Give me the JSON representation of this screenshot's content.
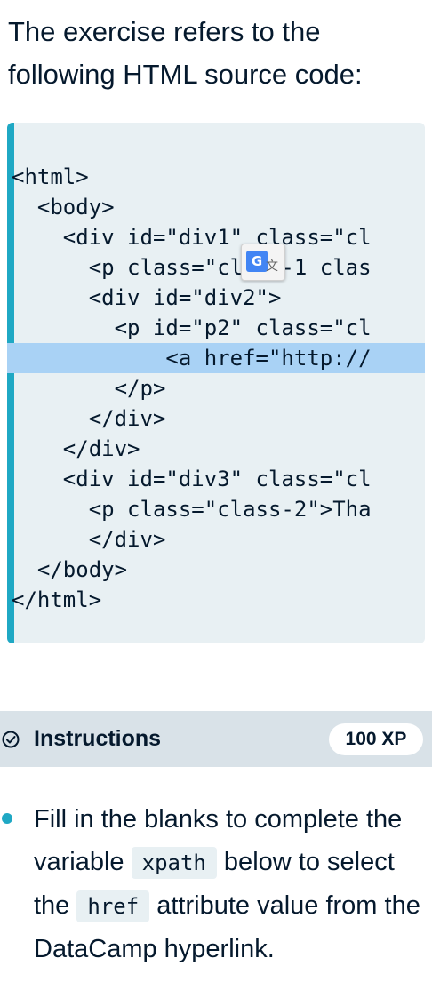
{
  "intro": {
    "text": "The exercise refers to the following HTML source code:"
  },
  "code": {
    "lines": [
      "<html>",
      "  <body>",
      "    <div id=\"div1\" class=\"cl",
      "      <p class=\"class-1 clas",
      "      <div id=\"div2\">",
      "        <p id=\"p2\" class=\"cl",
      "            <a href=\"http://",
      "        </p>",
      "      </div>",
      "    </div>",
      "    <div id=\"div3\" class=\"cl",
      "      <p class=\"class-2\">Tha",
      "      </div>",
      "  </body>",
      "</html>"
    ],
    "highlighted_line": 6
  },
  "translate_overlay": {
    "icon": "google-translate-icon",
    "letter": "G",
    "mark": "文"
  },
  "instructions": {
    "title": "Instructions",
    "xp": "100 XP",
    "check_icon": "check-circle-icon",
    "bullet": {
      "before_xpath": "Fill in the blanks to complete the variable ",
      "code_1": "xpath",
      "between": " below to select the ",
      "code_2": "href",
      "after": " attribute value from the DataCamp hyperlink."
    }
  },
  "colors": {
    "accent": "#1fa8c4",
    "code_bg": "#e8f0f3",
    "highlight": "#a9d2f5",
    "instructions_bar": "#d9e2e8",
    "text": "#05192d"
  }
}
